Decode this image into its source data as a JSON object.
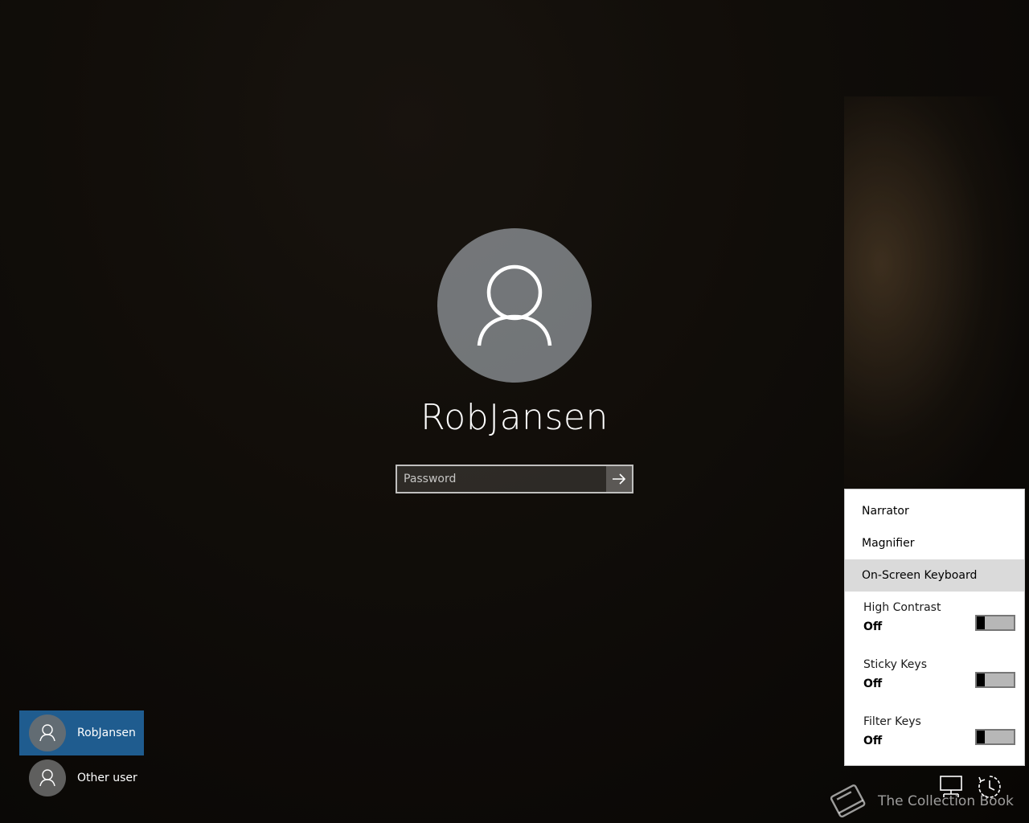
{
  "login": {
    "username": "RobJansen",
    "password_placeholder": "Password"
  },
  "users": [
    {
      "name": "RobJansen",
      "selected": true
    },
    {
      "name": "Other user",
      "selected": false
    }
  ],
  "ease_of_access": {
    "menu_items": [
      "Narrator",
      "Magnifier",
      "On-Screen Keyboard"
    ],
    "highlighted_item": "On-Screen Keyboard",
    "toggles": [
      {
        "label": "High Contrast",
        "state": "Off"
      },
      {
        "label": "Sticky Keys",
        "state": "Off"
      },
      {
        "label": "Filter Keys",
        "state": "Off"
      }
    ]
  },
  "system_icons": [
    "network-icon",
    "ease-of-access-icon"
  ],
  "watermark": {
    "text": "The Collection Book",
    "icon": "book-icon"
  },
  "colors": {
    "selected_user_bg": "#1f5c8f",
    "flyout_bg": "#ffffff",
    "flyout_hover": "#dadada"
  }
}
